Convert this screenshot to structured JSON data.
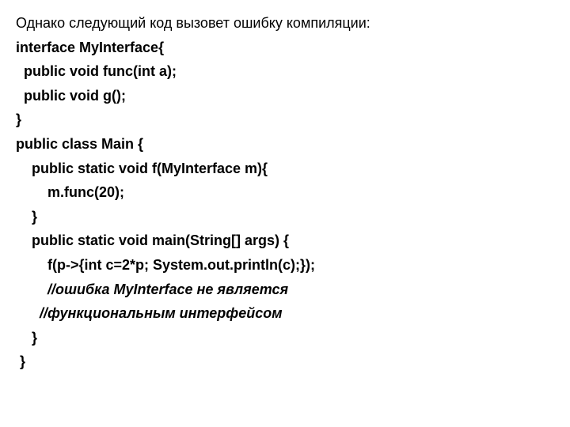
{
  "intro": "Однако следующий код вызовет ошибку компиляции:",
  "code": {
    "l1": "interface MyInterface{",
    "l2": "  public void func(int a);",
    "l3": "  public void g();",
    "l4": "}",
    "l5": "public class Main {",
    "l6": "    public static void f(MyInterface m){",
    "l7": "        m.func(20);",
    "l8": "    }",
    "l9": "    public static void main(String[] args) {",
    "l10": "        f(p->{int c=2*p; System.out.println(c);});",
    "l11": "        //ошибка MyInterface не является",
    "l12": "      //функциональным интерфейсом",
    "l13": "    }",
    "l14": " }"
  }
}
